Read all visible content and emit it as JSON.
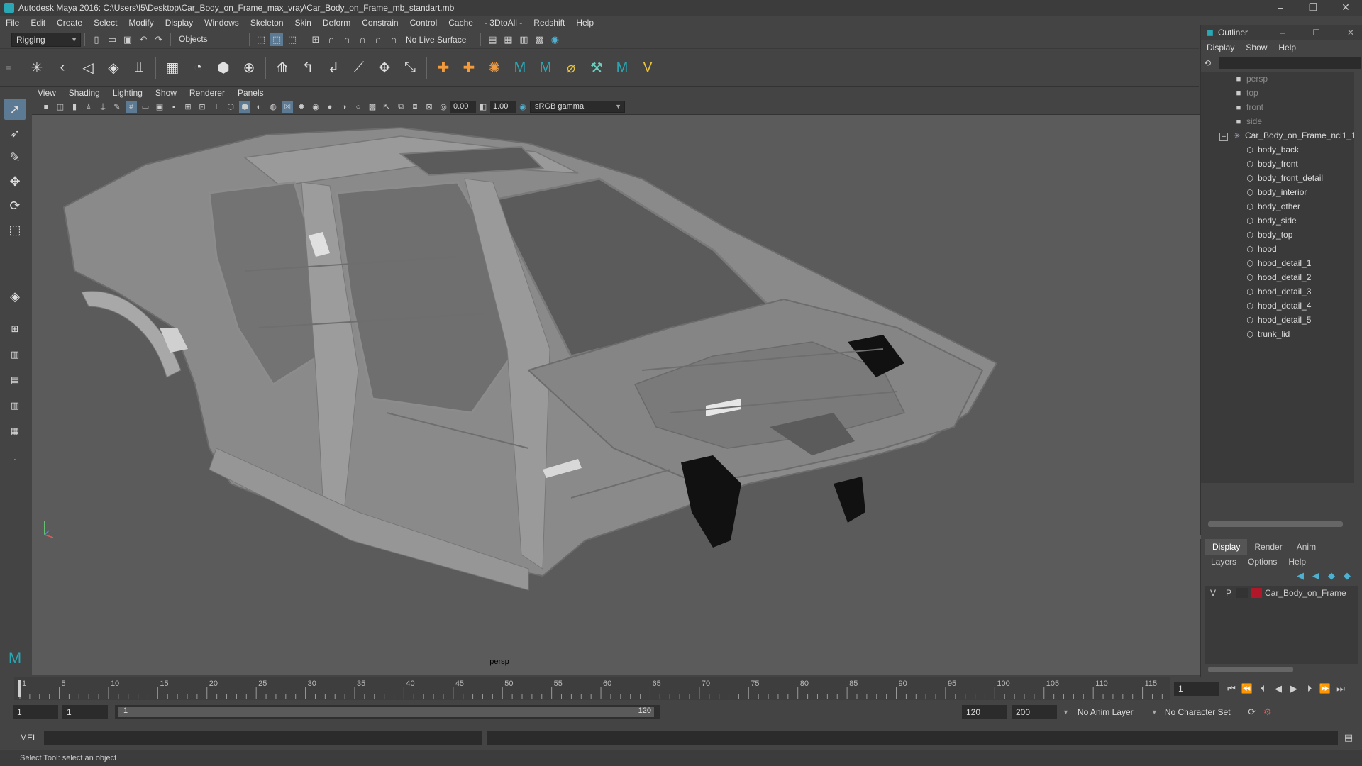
{
  "window": {
    "title": "Autodesk Maya 2016: C:\\Users\\l5\\Desktop\\Car_Body_on_Frame_max_vray\\Car_Body_on_Frame_mb_standart.mb",
    "minimize": "–",
    "maximize": "❐",
    "close": "✕"
  },
  "menubar": [
    "File",
    "Edit",
    "Create",
    "Select",
    "Modify",
    "Display",
    "Windows",
    "Skeleton",
    "Skin",
    "Deform",
    "Constrain",
    "Control",
    "Cache",
    "- 3DtoAll -",
    "Redshift",
    "Help"
  ],
  "statusline": {
    "menu_set": "Rigging",
    "selection_mode": "Objects",
    "live_surface": "No Live Surface"
  },
  "viewport": {
    "menus": [
      "View",
      "Shading",
      "Lighting",
      "Show",
      "Renderer",
      "Panels"
    ],
    "exposure": "0.00",
    "gamma": "1.00",
    "color_space": "sRGB gamma",
    "camera_label": "persp"
  },
  "outliner": {
    "title": "Outliner",
    "menus": [
      "Display",
      "Show",
      "Help"
    ],
    "cameras": [
      "persp",
      "top",
      "front",
      "side"
    ],
    "root": "Car_Body_on_Frame_ncl1_1",
    "children": [
      "body_back",
      "body_front",
      "body_front_detail",
      "body_interior",
      "body_other",
      "body_side",
      "body_top",
      "hood",
      "hood_detail_1",
      "hood_detail_2",
      "hood_detail_3",
      "hood_detail_4",
      "hood_detail_5",
      "trunk_lid"
    ]
  },
  "layer_editor": {
    "tabs": [
      "Display",
      "Render",
      "Anim"
    ],
    "menus": [
      "Layers",
      "Options",
      "Help"
    ],
    "layer": {
      "v": "V",
      "p": "P",
      "name": "Car_Body_on_Frame",
      "color": "#b0182a"
    }
  },
  "timeline": {
    "ticks": [
      "1",
      "5",
      "10",
      "15",
      "20",
      "25",
      "30",
      "35",
      "40",
      "45",
      "50",
      "55",
      "60",
      "65",
      "70",
      "75",
      "80",
      "85",
      "90",
      "95",
      "100",
      "105",
      "110",
      "115",
      "120"
    ],
    "current_frame": "1"
  },
  "range": {
    "start": "1",
    "playback_start": "1",
    "slider_start": "1",
    "slider_end": "120",
    "playback_end": "120",
    "end": "200",
    "anim_layer": "No Anim Layer",
    "character_set": "No Character Set"
  },
  "cmdline": {
    "label": "MEL"
  },
  "helpline": {
    "text": "Select Tool: select an object"
  },
  "colors": {
    "accent": "#2aa7b5",
    "selected_tool": "#5d7a94",
    "layer_color": "#b0182a"
  }
}
